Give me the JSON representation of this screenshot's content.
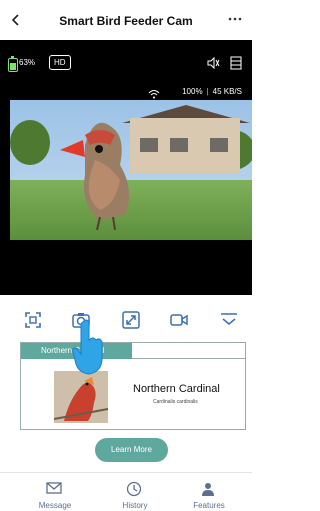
{
  "header": {
    "title": "Smart Bird Feeder Cam",
    "back_icon": "chevron-left-icon",
    "more_icon": "more-dots-icon"
  },
  "video": {
    "battery_text": "63%",
    "hd_label": "HD",
    "wifi_text": "100%",
    "speed_text": "45 KB/S",
    "mute_icon": "speaker-muted-icon",
    "layers_icon": "stack-icon"
  },
  "toolbar": {
    "tools": [
      {
        "name": "fullscreen-icon"
      },
      {
        "name": "camera-icon"
      },
      {
        "name": "expand-arrows-icon"
      },
      {
        "name": "video-camera-icon"
      },
      {
        "name": "collapse-chevron-icon"
      }
    ]
  },
  "card": {
    "tab_label": "Northern Cardinal",
    "bird_name": "Northern Cardinal",
    "bird_subtitle": "Cardinalis cardinalis"
  },
  "learn_more": "Learn More",
  "bottom_nav": {
    "message": "Message",
    "history": "History",
    "features": "Features"
  },
  "colors": {
    "accent": "#5fa89e",
    "battery": "#7ee06f",
    "nav_text": "#5c6f8f"
  }
}
